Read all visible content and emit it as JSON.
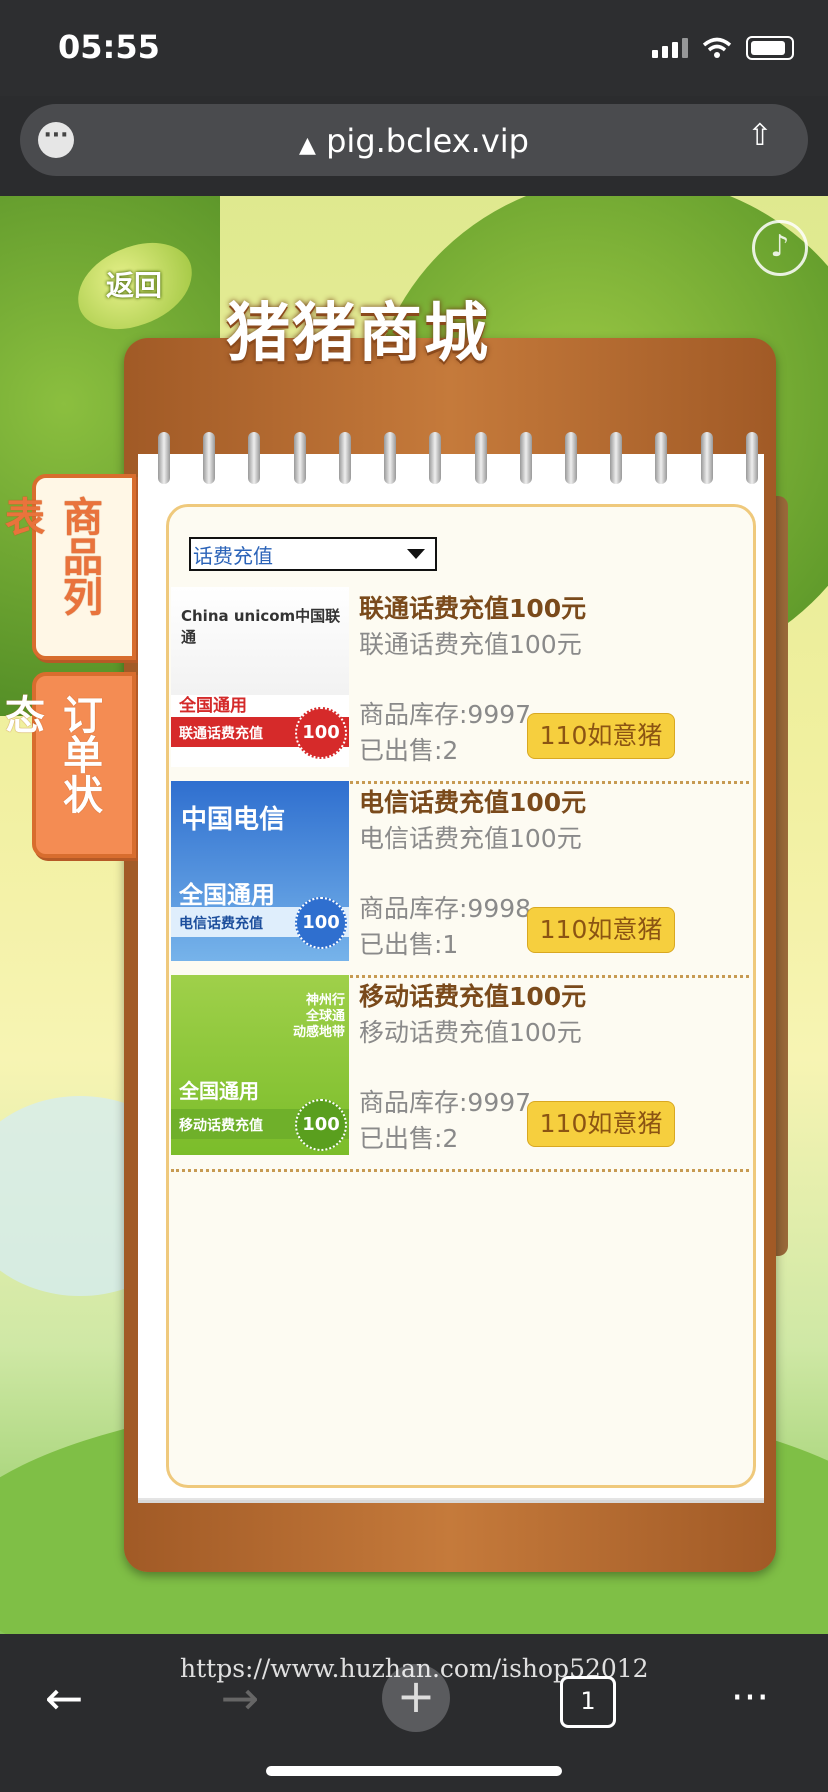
{
  "status_bar": {
    "time": "05:55"
  },
  "browser": {
    "url": "pig.bclex.vip"
  },
  "header": {
    "back_label": "返回",
    "title": "猪猪商城"
  },
  "tabs": [
    {
      "label": "商品列表"
    },
    {
      "label": "订单状态"
    }
  ],
  "filter": {
    "selected": "话费充值"
  },
  "products": [
    {
      "card": {
        "brand": "China unicom中国联通",
        "nation": "全国通用",
        "strip": "联通话费充值",
        "badge": "100"
      },
      "name": "联通话费充值100元",
      "desc": "联通话费充值100元",
      "stock": "商品库存:9997",
      "sold": "已出售:2",
      "price": "110如意猪"
    },
    {
      "card": {
        "brand": "中国电信",
        "nation": "全国通用",
        "strip": "电信话费充值",
        "badge": "100"
      },
      "name": "电信话费充值100元",
      "desc": "电信话费充值100元",
      "stock": "商品库存:9998",
      "sold": "已出售:1",
      "price": "110如意猪"
    },
    {
      "card": {
        "brand": "神州行 全球通 动感地带",
        "nation": "全国通用",
        "strip": "移动话费充值",
        "badge": "100"
      },
      "name": "移动话费充值100元",
      "desc": "移动话费充值100元",
      "stock": "商品库存:9997",
      "sold": "已出售:2",
      "price": "110如意猪"
    }
  ],
  "bottom_bar": {
    "watermark": "https://www.huzhan.com/ishop52012"
  },
  "colors": {
    "accent": "#f6cf3e",
    "board": "#c57a3b",
    "tab": "#e9733c"
  }
}
